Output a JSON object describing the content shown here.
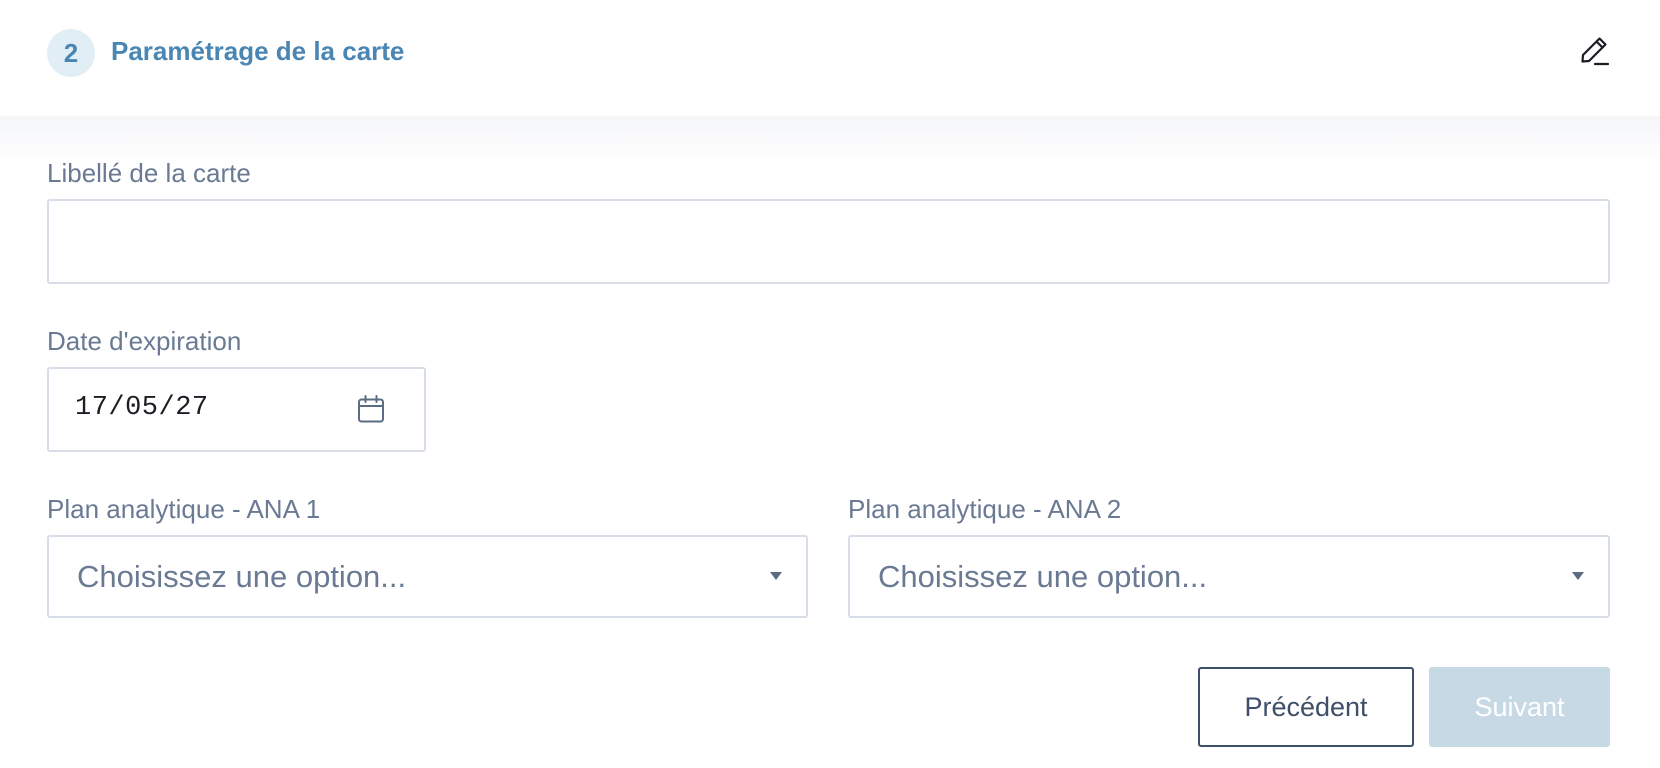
{
  "step": {
    "number": "2",
    "title": "Paramétrage de la carte",
    "edit_icon": "pencil-icon"
  },
  "form": {
    "card_label": {
      "label": "Libellé de la carte",
      "value": "",
      "placeholder": ""
    },
    "expiration": {
      "label": "Date d'expiration",
      "value": "17/05/27",
      "icon": "calendar-icon"
    },
    "ana1": {
      "label": "Plan analytique - ANA 1",
      "placeholder": "Choisissez une option..."
    },
    "ana2": {
      "label": "Plan analytique - ANA 2",
      "placeholder": "Choisissez une option..."
    }
  },
  "actions": {
    "previous_label": "Précédent",
    "next_label": "Suivant"
  },
  "colors": {
    "accent": "#4a86b4",
    "badge_bg": "#e2eef6",
    "label_text": "#6a7a93",
    "border": "#d8dee8",
    "secondary_button": "#3f4f6a",
    "primary_disabled_bg": "#c8d9e6"
  }
}
